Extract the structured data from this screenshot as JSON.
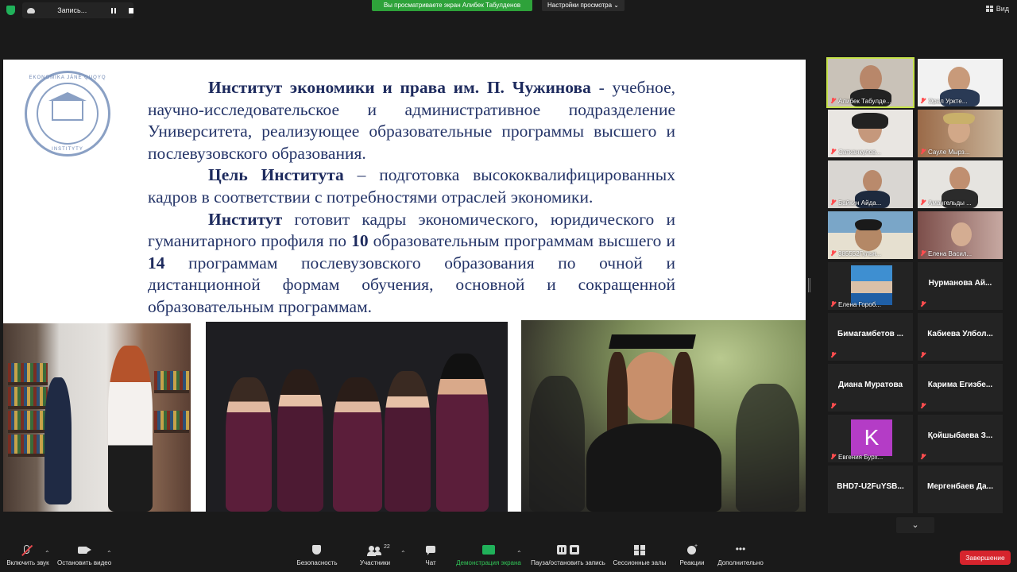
{
  "topbar": {
    "recording_label": "Запись...",
    "share_banner": "Вы просматриваете экран Алибек Табулденов",
    "view_settings": "Настройки просмотра ⌄",
    "view_label": "Вид"
  },
  "slide": {
    "logo_top": "EKONOMIKA JÁNE QUQYQ",
    "logo_bottom": "INSTITYTY",
    "p1_bold": "Институт экономики и права им. П. Чужинова",
    "p1_rest": " - учебное, научно-исследовательское и административное подразделение Университета, реализующее образовательные программы высшего и послевузовского образования.",
    "p2_bold": "Цель Института",
    "p2_rest": " – подготовка высококвалифицированных кадров в соответствии с потребностями отраслей экономики.",
    "p3_bold": "Институт",
    "p3_a": " готовит кадры экономического, юридического и гуманитарного профиля по ",
    "p3_n1": "10",
    "p3_b": " образовательным программам высшего и ",
    "p3_n2": "14",
    "p3_c": " программам послевузовского образования по очной и дистанционной формам обучения, основной и сокращенной образовательным программам."
  },
  "participants": [
    {
      "name": "Алибек Табулде...",
      "type": "video"
    },
    {
      "name": "Орал Уркте...",
      "type": "video"
    },
    {
      "name": "Сатканкулов...",
      "type": "video"
    },
    {
      "name": "Сауле Мырз...",
      "type": "video"
    },
    {
      "name": "Байкин Айда...",
      "type": "video"
    },
    {
      "name": "Амангельды ...",
      "type": "video"
    },
    {
      "name": "385552Гульн...",
      "type": "video"
    },
    {
      "name": "Елена Васил...",
      "type": "video"
    },
    {
      "name": "Елена Гороб...",
      "type": "photo"
    },
    {
      "name": "Нурманова Ай...",
      "type": "text"
    },
    {
      "name": "Бимагамбетов ...",
      "type": "text"
    },
    {
      "name": "Кабиева Улбол...",
      "type": "text"
    },
    {
      "name": "Диана Муратова",
      "type": "text"
    },
    {
      "name": "Карима Егизбе...",
      "type": "text"
    },
    {
      "name": "Евгения Бурх...",
      "type": "avatar",
      "letter": "K"
    },
    {
      "name": "Қойшыбаева З...",
      "type": "text"
    },
    {
      "name": "BHD7-U2FuYSB...",
      "type": "text"
    },
    {
      "name": "Мергенбаев Да...",
      "type": "text"
    }
  ],
  "toolbar": {
    "mute": "Включить звук",
    "video": "Остановить видео",
    "security": "Безопасность",
    "participants": "Участники",
    "participants_count": "22",
    "chat": "Чат",
    "share": "Демонстрация экрана",
    "record": "Пауза/остановить запись",
    "breakout": "Сессионные залы",
    "reactions": "Реакции",
    "more": "Дополнительно",
    "end": "Завершение"
  },
  "colors": {
    "share_green": "#2ea23a",
    "end_red": "#d6242d",
    "active_speaker": "#c6e34a",
    "slide_text": "#243468"
  }
}
